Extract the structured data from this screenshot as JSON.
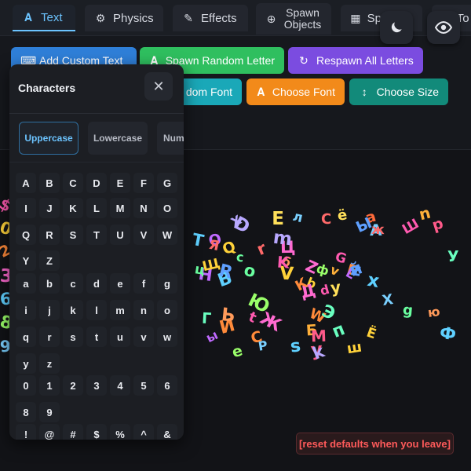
{
  "tabs": [
    {
      "label": "Text",
      "icon": "letter-a-icon",
      "active": true
    },
    {
      "label": "Physics",
      "icon": "gear-icon"
    },
    {
      "label": "Effects",
      "icon": "pencil-icon"
    },
    {
      "label": "Spawn Objects",
      "icon": "plus-circle-icon"
    },
    {
      "label": "Spawn...",
      "icon": "grid-icon"
    },
    {
      "label": "To",
      "icon": "tools-icon"
    }
  ],
  "theme_icon": "moon-icon",
  "visibility_icon": "eye-icon",
  "actions": {
    "add_custom_text": "Add Custom Text",
    "spawn_random_letter": "Spawn Random Letter",
    "respawn_all_letters": "Respawn All Letters",
    "random_font": "dom Font",
    "choose_font": "Choose Font",
    "choose_size": "Choose Size"
  },
  "colors": {
    "blue": "#2f7fd8",
    "green": "#2fbf5f",
    "purple": "#7b4ce0",
    "teal": "#1aa8b8",
    "orange": "#f28a1a",
    "dark_teal": "#128a7a"
  },
  "panel": {
    "title": "Characters",
    "close_label": "✕",
    "case_tabs": [
      "Uppercase",
      "Lowercase",
      "Num"
    ],
    "rows": [
      [
        "A",
        "B",
        "C",
        "D",
        "E",
        "F",
        "G"
      ],
      [
        "I",
        "J",
        "K",
        "L",
        "M",
        "N",
        "O"
      ],
      [
        "Q",
        "R",
        "S",
        "T",
        "U",
        "V",
        "W"
      ],
      [
        "Y",
        "Z"
      ],
      [
        "a",
        "b",
        "c",
        "d",
        "e",
        "f",
        "g"
      ],
      [
        "i",
        "j",
        "k",
        "l",
        "m",
        "n",
        "o"
      ],
      [
        "q",
        "r",
        "s",
        "t",
        "u",
        "v",
        "w"
      ],
      [
        "y",
        "z"
      ],
      [
        "0",
        "1",
        "2",
        "3",
        "4",
        "5",
        "6"
      ],
      [
        "8",
        "9"
      ],
      [
        "!",
        "@",
        "#",
        "$",
        "%",
        "^",
        "&"
      ]
    ]
  },
  "reset_label": "[reset defaults when you leave]",
  "letters": [
    {
      "ch": "d",
      "c": "#ff5ab0"
    },
    {
      "ch": "b",
      "c": "#ffd23a"
    },
    {
      "ch": "E",
      "c": "#ff8a3a"
    },
    {
      "ch": "a",
      "c": "#ff6a3a"
    },
    {
      "ch": "A",
      "c": "#7ad0ff"
    },
    {
      "ch": "D",
      "c": "#b8a8ff"
    },
    {
      "ch": "B",
      "c": "#5fd0ff"
    },
    {
      "ch": "Д",
      "c": "#ff6ad0"
    },
    {
      "ch": "e",
      "c": "#9aff6a"
    },
    {
      "ch": "G",
      "c": "#ff5ab0"
    },
    {
      "ch": "б",
      "c": "#ff9a5a"
    },
    {
      "ch": "C",
      "c": "#ff8a3a"
    },
    {
      "ch": "z",
      "c": "#5fa0ff"
    },
    {
      "ch": "Q",
      "c": "#ffd23a"
    },
    {
      "ch": "H",
      "c": "#c06aff"
    },
    {
      "ch": "У",
      "c": "#6affc0"
    },
    {
      "ch": "Б",
      "c": "#ffb03a"
    },
    {
      "ch": "r",
      "c": "#ff6a6a"
    },
    {
      "ch": "Ж",
      "c": "#ff6ad0"
    },
    {
      "ch": "Ф",
      "c": "#5fd0ff"
    },
    {
      "ch": "ё",
      "c": "#ffe05a"
    },
    {
      "ch": "o",
      "c": "#6affa0"
    },
    {
      "ch": "P",
      "c": "#7ad0ff"
    },
    {
      "ch": "L",
      "c": "#c06aff"
    },
    {
      "ch": "M",
      "c": "#ff5a8a"
    },
    {
      "ch": "И",
      "c": "#ff8a3a"
    },
    {
      "ch": "T",
      "c": "#5fd0ff"
    },
    {
      "ch": "Ё",
      "c": "#ffd23a"
    },
    {
      "ch": "Х",
      "c": "#b8a8ff"
    },
    {
      "ch": "п",
      "c": "#6affc0"
    },
    {
      "ch": "С",
      "c": "#ff6a6a"
    },
    {
      "ch": "Щ",
      "c": "#ffd23a"
    },
    {
      "ch": "Ш",
      "c": "#ff5ab0"
    },
    {
      "ch": "Ы",
      "c": "#5fa0ff"
    },
    {
      "ch": "ф",
      "c": "#9aff6a"
    },
    {
      "ch": "W",
      "c": "#ff8a3a"
    },
    {
      "ch": "X",
      "c": "#7ad0ff"
    },
    {
      "ch": "ы",
      "c": "#c06aff"
    },
    {
      "ch": "с",
      "c": "#6affa0"
    },
    {
      "ch": "Z",
      "c": "#ff6ad0"
    },
    {
      "ch": "v",
      "c": "#ffb03a"
    },
    {
      "ch": "x",
      "c": "#5fd0ff"
    },
    {
      "ch": "у",
      "c": "#ff5a8a"
    },
    {
      "ch": "Э",
      "c": "#6affc0"
    },
    {
      "ch": "$",
      "c": "#ff5ab0"
    },
    {
      "ch": "0",
      "c": "#ffd23a"
    },
    {
      "ch": "2",
      "c": "#ff8a3a"
    },
    {
      "ch": "3",
      "c": "#ff6ad0"
    },
    {
      "ch": "6",
      "c": "#5fd0ff"
    },
    {
      "ch": "8",
      "c": "#9aff6a"
    },
    {
      "ch": "9",
      "c": "#7ad0ff"
    },
    {
      "ch": "ю",
      "c": "#ff9a5a"
    },
    {
      "ch": "k",
      "c": "#b8a8ff"
    },
    {
      "ch": "ж",
      "c": "#ff6a6a"
    },
    {
      "ch": "Е",
      "c": "#ffe05a"
    },
    {
      "ch": "ц",
      "c": "#6affa0"
    },
    {
      "ch": "t",
      "c": "#ff5ab0"
    },
    {
      "ch": "й",
      "c": "#5fa0ff"
    },
    {
      "ch": "V",
      "c": "#ffd23a"
    },
    {
      "ch": "O",
      "c": "#c06aff"
    },
    {
      "ch": "К",
      "c": "#ff8a3a"
    },
    {
      "ch": "Г",
      "c": "#6affc0"
    },
    {
      "ch": "р",
      "c": "#ff5a8a"
    },
    {
      "ch": "л",
      "c": "#7ad0ff"
    },
    {
      "ch": "n",
      "c": "#ffb03a"
    },
    {
      "ch": "Ц",
      "c": "#ff6ad0"
    },
    {
      "ch": "Ю",
      "c": "#9aff6a"
    },
    {
      "ch": "s",
      "c": "#5fd0ff"
    },
    {
      "ch": "Я",
      "c": "#ff6a6a"
    },
    {
      "ch": "ш",
      "c": "#ffd23a"
    },
    {
      "ch": "m",
      "c": "#b8a8ff"
    },
    {
      "ch": "g",
      "c": "#6affa0"
    },
    {
      "ch": "Ь",
      "c": "#ff9a5a"
    },
    {
      "ch": "K",
      "c": "#ff5ab0"
    },
    {
      "ch": "R",
      "c": "#5fa0ff"
    },
    {
      "ch": "y",
      "c": "#ffe05a"
    }
  ]
}
